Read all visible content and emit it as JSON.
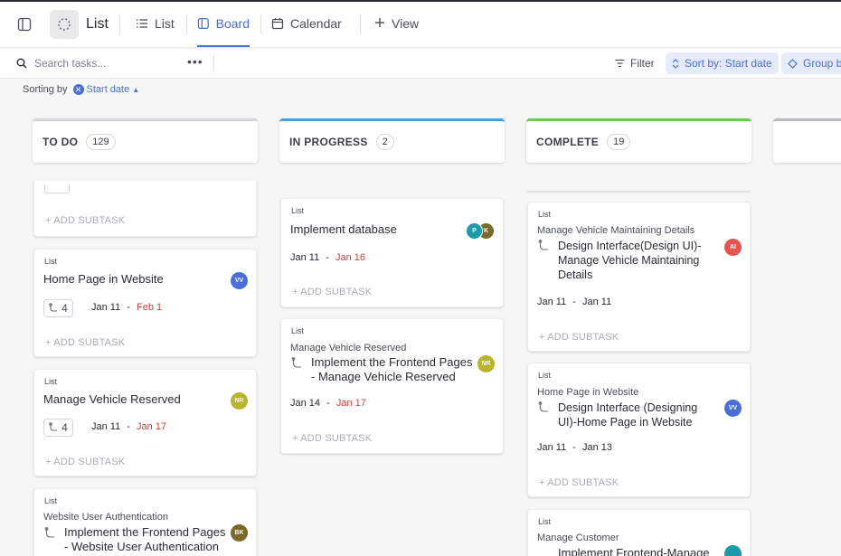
{
  "header": {
    "title": "List",
    "tabs": [
      {
        "label": "List",
        "icon": "list-icon"
      },
      {
        "label": "Board",
        "icon": "board-icon",
        "active": true
      },
      {
        "label": "Calendar",
        "icon": "calendar-icon"
      },
      {
        "label": "View",
        "icon": "plus-icon"
      }
    ],
    "add_view_label": "View"
  },
  "toolbar": {
    "search_placeholder": "Search tasks...",
    "more": "•••",
    "filter_label": "Filter",
    "sort_label": "Sort by: Start date",
    "group_label": "Group b"
  },
  "sorting": {
    "label": "Sorting by",
    "chip_label": "Start date"
  },
  "accent": "#4a6fd8",
  "columns": [
    {
      "name": "TO DO",
      "count": "129",
      "color": "#d3d5d9"
    },
    {
      "name": "IN PROGRESS",
      "count": "2",
      "color": "#4a9fe0"
    },
    {
      "name": "COMPLETE",
      "count": "19",
      "color": "#6bc950"
    }
  ],
  "cards": {
    "todo": [
      {
        "add_subtask": "+ ADD SUBTASK"
      },
      {
        "list": "List",
        "title": "Home Page in Website",
        "subtasks": "4",
        "start": "Jan 11",
        "sep": "-",
        "due": "Feb 1",
        "assignee": "VV",
        "assignee_color": "#4a6fd8",
        "add_subtask": "+ ADD SUBTASK"
      },
      {
        "list": "List",
        "title": "Manage Vehicle Reserved",
        "subtasks": "4",
        "start": "Jan 11",
        "sep": "-",
        "due": "Jan 17",
        "assignee": "NR",
        "assignee_color": "#b8b42e",
        "add_subtask": "+ ADD SUBTASK"
      },
      {
        "list": "List",
        "parent": "Website User Authentication",
        "title_1": "Implement the Frontend Pages",
        "title_2": "- Website User Authentication",
        "assignee": "BK",
        "assignee_color": "#7a6a2a"
      }
    ],
    "inprogress": [
      {
        "list": "List",
        "title": "Implement database",
        "start": "Jan 11",
        "sep": "-",
        "due": "Jan 16",
        "assignee": "P",
        "assignee_color": "#1e9aa8",
        "assignee2": "K",
        "assignee2_color": "#7a6a2a",
        "add_subtask": "+ ADD SUBTASK"
      },
      {
        "list": "List",
        "parent": "Manage Vehicle Reserved",
        "title_1": "Implement the Frontend Pages",
        "title_2": "- Manage Vehicle Reserved",
        "start": "Jan 14",
        "sep": "-",
        "due": "Jan 17",
        "assignee": "NR",
        "assignee_color": "#b8b42e",
        "add_subtask": "+ ADD SUBTASK"
      }
    ],
    "complete": [
      {
        "list": "List",
        "parent": "Manage Vehicle Maintaining Details",
        "title_1": "Design Interface(Design UI)-",
        "title_2": "Manage Vehicle Maintaining",
        "title_3": "Details",
        "start": "Jan 11",
        "sep": "-",
        "due": "Jan 11",
        "assignee": "AI",
        "assignee_color": "#e8534f",
        "add_subtask": "+ ADD SUBTASK"
      },
      {
        "list": "List",
        "parent": "Home Page in Website",
        "title_1": "Design Interface (Designing",
        "title_2": "UI)-Home Page in Website",
        "start": "Jan 11",
        "sep": "-",
        "due": "Jan 13",
        "assignee": "VV",
        "assignee_color": "#4a6fd8",
        "add_subtask": "+ ADD SUBTASK"
      },
      {
        "list": "List",
        "parent": "Manage Customer",
        "title_1": "Implement Frontend-Manage",
        "assignee_color": "#1e9aa8"
      }
    ]
  }
}
